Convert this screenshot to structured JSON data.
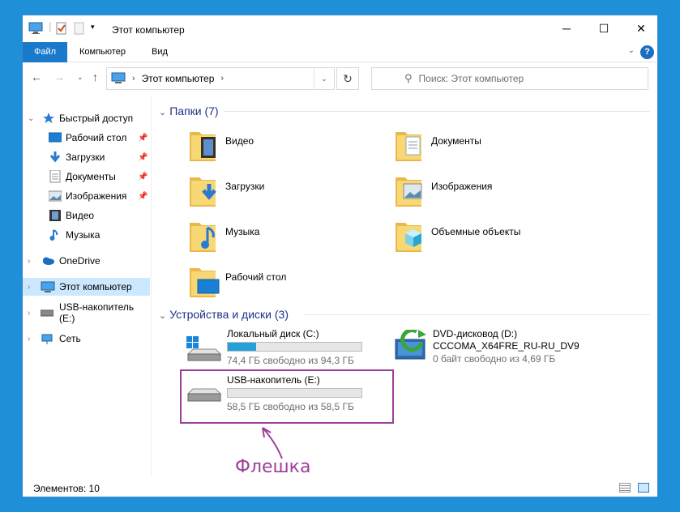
{
  "window": {
    "title": "Этот компьютер"
  },
  "ribbon": {
    "tabs": [
      "Файл",
      "Компьютер",
      "Вид"
    ],
    "help": "?"
  },
  "address": {
    "location": "Этот компьютер",
    "search_placeholder": "Поиск: Этот компьютер"
  },
  "sidebar": {
    "quick_access": "Быстрый доступ",
    "pinned": [
      {
        "label": "Рабочий стол",
        "icon": "desktop-icon",
        "pinned": true
      },
      {
        "label": "Загрузки",
        "icon": "downloads-icon",
        "pinned": true
      },
      {
        "label": "Документы",
        "icon": "documents-icon",
        "pinned": true
      },
      {
        "label": "Изображения",
        "icon": "pictures-icon",
        "pinned": true
      },
      {
        "label": "Видео",
        "icon": "video-icon",
        "pinned": false
      },
      {
        "label": "Музыка",
        "icon": "music-icon",
        "pinned": false
      }
    ],
    "onedrive": "OneDrive",
    "this_pc": "Этот компьютер",
    "usb": "USB-накопитель (E:)",
    "network": "Сеть"
  },
  "folders_section": {
    "title": "Папки (7)",
    "items": [
      "Видео",
      "Документы",
      "Загрузки",
      "Изображения",
      "Музыка",
      "Объемные объекты",
      "Рабочий стол"
    ]
  },
  "drives_section": {
    "title": "Устройства и диски (3)",
    "drives": [
      {
        "name": "Локальный диск (C:)",
        "free": "74,4 ГБ свободно из 94,3 ГБ",
        "used_fraction": 0.21
      },
      {
        "name": "DVD-дисковод (D:)",
        "label": "CCCOMA_X64FRE_RU-RU_DV9",
        "free": "0 байт свободно из 4,69 ГБ"
      },
      {
        "name": "USB-накопитель (E:)",
        "free": "58,5 ГБ свободно из 58,5 ГБ",
        "used_fraction": 0.0
      }
    ]
  },
  "annotation": "Флешка",
  "status": {
    "items": "Элементов: 10"
  },
  "colors": {
    "accent": "#1979ca",
    "highlight": "#9b3f9b",
    "section": "#1e3287",
    "bar": "#26a0da"
  }
}
